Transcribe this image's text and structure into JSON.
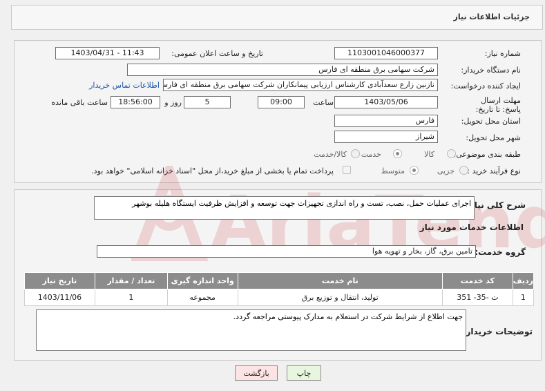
{
  "header": {
    "title": "جزئیات اطلاعات نیاز"
  },
  "form": {
    "need_number_label": "شماره نیاز:",
    "need_number": "1103001046000377",
    "announce_datetime_label": "تاریخ و ساعت اعلان عمومی:",
    "announce_datetime": "1403/04/31 - 11:43",
    "buyer_org_label": "نام دستگاه خریدار:",
    "buyer_org": "شرکت سهامی برق منطقه ای فارس",
    "requester_label": "ایجاد کننده درخواست:",
    "requester": "نازنین زارع سعدآبادی کارشناس ارزیابی پیمانکاران شرکت سهامی برق منطقه ای فارس",
    "contact_link": "اطلاعات تماس خریدار",
    "deadline_label": "مهلت ارسال پاسخ: تا تاریخ:",
    "deadline_date": "1403/05/06",
    "time_label": "ساعت",
    "deadline_time": "09:00",
    "days_value": "5",
    "days_label": "روز و",
    "remaining_time": "18:56:00",
    "remaining_label": "ساعت باقی مانده",
    "province_label": "استان محل تحویل:",
    "province": "فارس",
    "city_label": "شهر محل تحویل:",
    "city": "شیراز",
    "category_label": "طبقه بندی موضوعی:",
    "category_options": {
      "goods": "کالا",
      "service": "خدمت",
      "goods_service": "کالا/خدمت"
    },
    "process_label": "نوع فرآیند خرید :",
    "process_options": {
      "partial": "جزیی",
      "medium": "متوسط"
    },
    "payment_note": "پرداخت تمام یا بخشی از مبلغ خرید،از محل \"اسناد خزانه اسلامی\" خواهد بود."
  },
  "details": {
    "summary_label": "شرح کلی نیاز:",
    "summary": "اجرای عملیات حمل، نصب، تست و راه اندازی تجهیزات جهت توسعه و افزایش ظرفیت ایستگاه هلیله بوشهر",
    "services_heading": "اطلاعات خدمات مورد نیاز",
    "service_group_label": "گروه خدمت:",
    "service_group": "تامین برق، گاز، بخار و تهویه هوا",
    "table": {
      "headers": [
        "ردیف",
        "کد خدمت",
        "نام خدمت",
        "واحد اندازه گیری",
        "تعداد / مقدار",
        "تاریخ نیاز"
      ],
      "rows": [
        [
          "1",
          "ت -35- 351",
          "تولید، انتقال و توزیع برق",
          "مجموعه",
          "1",
          "1403/11/06"
        ]
      ]
    },
    "buyer_notes_label": "توضیحات خریدار:",
    "buyer_notes": "جهت اطلاع از شرایط شرکت در استعلام به مدارک پیوستی مراجعه گردد."
  },
  "buttons": {
    "print": "چاپ",
    "back": "بازگشت"
  },
  "watermark": {
    "text": "AriaTender.net"
  },
  "colors": {
    "header_table": "#8c8c8c",
    "link": "#1a55a8",
    "print_bg": "#e8f6e0",
    "back_bg": "#fce4e4",
    "watermark": "#c62828"
  }
}
